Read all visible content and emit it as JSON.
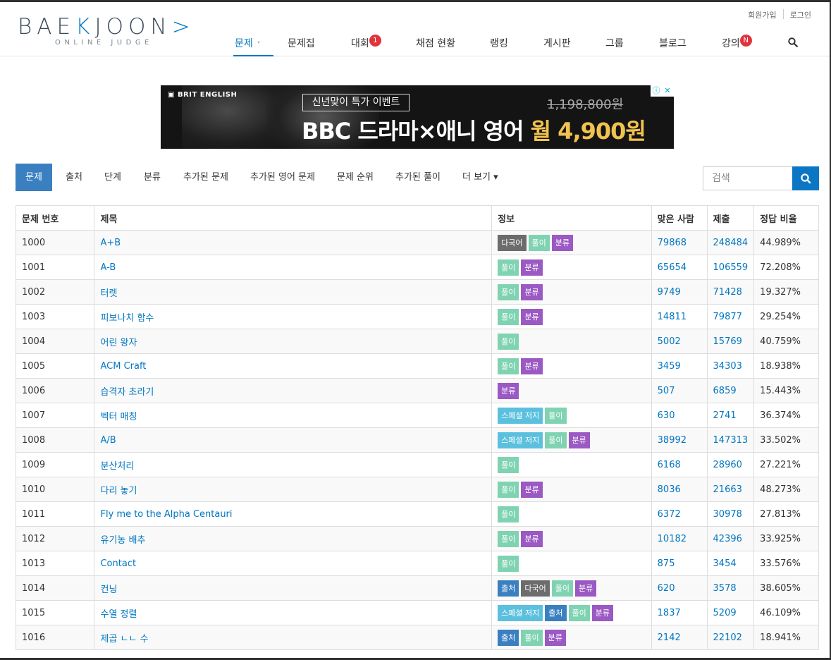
{
  "header": {
    "logo_main_a": "BAE",
    "logo_k": "K",
    "logo_main_b": "JOON",
    "logo_chev": ">",
    "logo_sub": "ONLINE JUDGE",
    "util": {
      "signup": "회원가입",
      "login": "로그인"
    },
    "nav": [
      {
        "label": "문제",
        "active": true
      },
      {
        "label": "문제집"
      },
      {
        "label": "대회",
        "badge": "1"
      },
      {
        "label": "채점 현황"
      },
      {
        "label": "랭킹"
      },
      {
        "label": "게시판"
      },
      {
        "label": "그룹"
      },
      {
        "label": "블로그"
      },
      {
        "label": "강의",
        "badge": "N"
      }
    ]
  },
  "ad": {
    "brand": "BRIT ENGLISH",
    "event": "신년맞이 특가 이벤트",
    "old_price": "1,198,800원",
    "headline_a": "BBC 드라마×애니 영어 ",
    "headline_b": "월 4,900원",
    "close_icons": [
      "ⓘ",
      "✕"
    ]
  },
  "subnav": [
    {
      "label": "문제",
      "active": true
    },
    {
      "label": "출처"
    },
    {
      "label": "단계"
    },
    {
      "label": "분류"
    },
    {
      "label": "추가된 문제"
    },
    {
      "label": "추가된 영어 문제"
    },
    {
      "label": "문제 순위"
    },
    {
      "label": "추가된 풀이"
    },
    {
      "label": "더 보기 ▾"
    }
  ],
  "search": {
    "placeholder": "검색"
  },
  "table": {
    "headers": [
      "문제 번호",
      "제목",
      "정보",
      "맞은 사람",
      "제출",
      "정답 비율"
    ],
    "rows": [
      {
        "id": "1000",
        "title": "A+B",
        "tags": [
          "다국어",
          "풀이",
          "분류"
        ],
        "solved": "79868",
        "submit": "248484",
        "ratio": "44.989%"
      },
      {
        "id": "1001",
        "title": "A-B",
        "tags": [
          "풀이",
          "분류"
        ],
        "solved": "65654",
        "submit": "106559",
        "ratio": "72.208%"
      },
      {
        "id": "1002",
        "title": "터렛",
        "tags": [
          "풀이",
          "분류"
        ],
        "solved": "9749",
        "submit": "71428",
        "ratio": "19.327%"
      },
      {
        "id": "1003",
        "title": "피보나치 함수",
        "tags": [
          "풀이",
          "분류"
        ],
        "solved": "14811",
        "submit": "79877",
        "ratio": "29.254%"
      },
      {
        "id": "1004",
        "title": "어린 왕자",
        "tags": [
          "풀이"
        ],
        "solved": "5002",
        "submit": "15769",
        "ratio": "40.759%"
      },
      {
        "id": "1005",
        "title": "ACM Craft",
        "tags": [
          "풀이",
          "분류"
        ],
        "solved": "3459",
        "submit": "34303",
        "ratio": "18.938%"
      },
      {
        "id": "1006",
        "title": "습격자 초라기",
        "tags": [
          "분류"
        ],
        "solved": "507",
        "submit": "6859",
        "ratio": "15.443%"
      },
      {
        "id": "1007",
        "title": "벡터 매칭",
        "tags": [
          "스페셜 저지",
          "풀이"
        ],
        "solved": "630",
        "submit": "2741",
        "ratio": "36.374%"
      },
      {
        "id": "1008",
        "title": "A/B",
        "tags": [
          "스페셜 저지",
          "풀이",
          "분류"
        ],
        "solved": "38992",
        "submit": "147313",
        "ratio": "33.502%"
      },
      {
        "id": "1009",
        "title": "분산처리",
        "tags": [
          "풀이"
        ],
        "solved": "6168",
        "submit": "28960",
        "ratio": "27.221%"
      },
      {
        "id": "1010",
        "title": "다리 놓기",
        "tags": [
          "풀이",
          "분류"
        ],
        "solved": "8036",
        "submit": "21663",
        "ratio": "48.273%"
      },
      {
        "id": "1011",
        "title": "Fly me to the Alpha Centauri",
        "tags": [
          "풀이"
        ],
        "solved": "6372",
        "submit": "30978",
        "ratio": "27.813%"
      },
      {
        "id": "1012",
        "title": "유기농 배추",
        "tags": [
          "풀이",
          "분류"
        ],
        "solved": "10182",
        "submit": "42396",
        "ratio": "33.925%"
      },
      {
        "id": "1013",
        "title": "Contact",
        "tags": [
          "풀이"
        ],
        "solved": "875",
        "submit": "3454",
        "ratio": "33.576%"
      },
      {
        "id": "1014",
        "title": "컨닝",
        "tags": [
          "출처",
          "다국어",
          "풀이",
          "분류"
        ],
        "solved": "620",
        "submit": "3578",
        "ratio": "38.605%"
      },
      {
        "id": "1015",
        "title": "수열 정렬",
        "tags": [
          "스페셜 저지",
          "출처",
          "풀이",
          "분류"
        ],
        "solved": "1837",
        "submit": "5209",
        "ratio": "46.109%"
      },
      {
        "id": "1016",
        "title": "제곱 ㄴㄴ 수",
        "tags": [
          "출처",
          "풀이",
          "분류"
        ],
        "solved": "2142",
        "submit": "22102",
        "ratio": "18.941%"
      }
    ]
  },
  "tag_colors": {
    "다국어": "#6c6c6c",
    "풀이": "#7fd3b2",
    "분류": "#9b59c3",
    "스페셜 저지": "#5bc0de",
    "출처": "#3a7fc0"
  }
}
